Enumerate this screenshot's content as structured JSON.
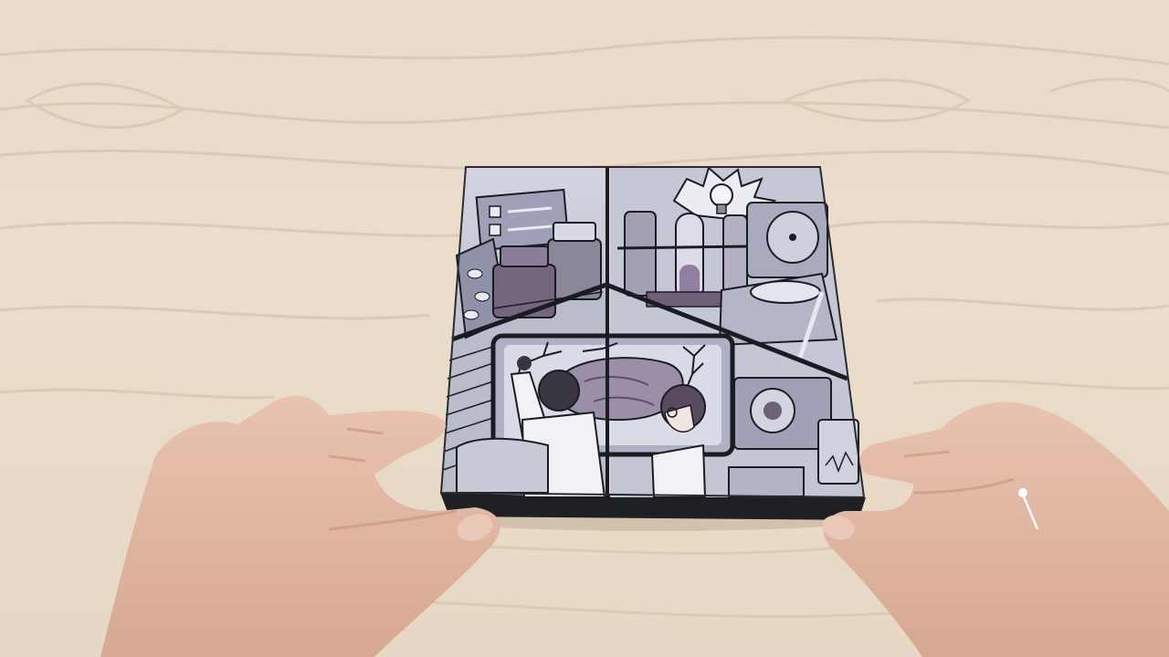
{
  "scene": {
    "subject": "photo-of-hands-holding-illustrated-flexagon-card",
    "colors": {
      "table": "#e8dbc9",
      "wood_grain": "#d9c6ae",
      "card_base": "#1f2023",
      "panel_bg": "#c9c9d8",
      "ink": "#1b1b22",
      "purple": "#7b6d88",
      "skin": "#e2b9a5"
    },
    "icons": [
      "lightbulb-icon",
      "brain-icon",
      "neuron-icon",
      "test-tube-icon",
      "pill-bottle-icon",
      "checklist-icon",
      "centrifuge-icon"
    ]
  }
}
